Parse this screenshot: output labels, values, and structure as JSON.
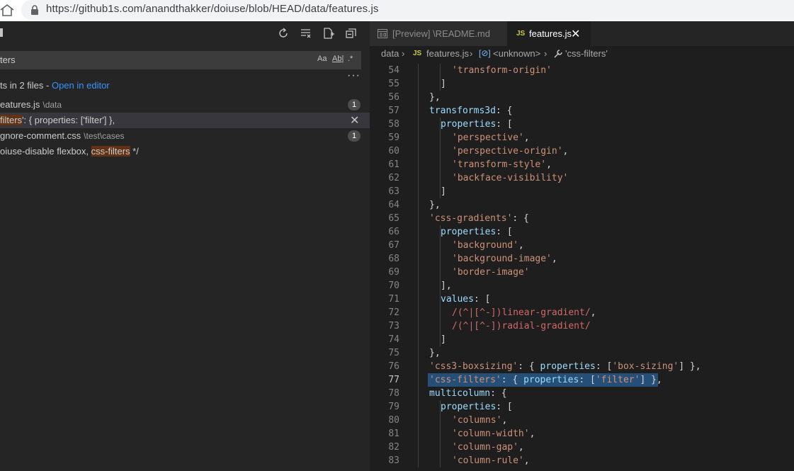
{
  "browser": {
    "url": "https://github1s.com/anandthakker/doiuse/blob/HEAD/data/features.js"
  },
  "search": {
    "query": "ters",
    "options": [
      "Aa",
      "Ab|",
      ".*"
    ],
    "summary_prefix": "ts in 2 files - ",
    "open_in_editor": "Open in editor"
  },
  "results": [
    {
      "file": "eatures.js",
      "path": "\\data",
      "count": "1"
    },
    {
      "match_pre": "",
      "match": "filters",
      "match_post": "': { properties: ['filter'] },"
    },
    {
      "file": "gnore-comment.css",
      "path": "\\test\\cases",
      "count": "1"
    },
    {
      "match_pre": "oiuse-disable flexbox, ",
      "match": "css-filters",
      "match_post": " */"
    }
  ],
  "tabs": [
    {
      "label": "[Preview] \\README.md",
      "active": false
    },
    {
      "label": "features.js",
      "active": true,
      "badge": "JS"
    }
  ],
  "breadcrumb": [
    "data",
    "features.js",
    "<unknown>",
    "'css-filters'"
  ],
  "code": {
    "current_line": 77,
    "lines": [
      {
        "n": "54",
        "tokens": [
          [
            "s",
            "'transform-origin'"
          ]
        ],
        "indent": 2
      },
      {
        "n": "55",
        "tokens": [
          [
            "p",
            "]"
          ]
        ],
        "indent": 1
      },
      {
        "n": "56",
        "tokens": [
          [
            "p",
            "},"
          ]
        ],
        "indent": 0
      },
      {
        "n": "57",
        "tokens": [
          [
            "k",
            "transforms3d"
          ],
          [
            "p",
            ": {"
          ]
        ],
        "indent": 0
      },
      {
        "n": "58",
        "tokens": [
          [
            "k",
            "properties"
          ],
          [
            "p",
            ": ["
          ]
        ],
        "indent": 1
      },
      {
        "n": "59",
        "tokens": [
          [
            "s",
            "'perspective'"
          ],
          [
            "p",
            ","
          ]
        ],
        "indent": 2
      },
      {
        "n": "60",
        "tokens": [
          [
            "s",
            "'perspective-origin'"
          ],
          [
            "p",
            ","
          ]
        ],
        "indent": 2
      },
      {
        "n": "61",
        "tokens": [
          [
            "s",
            "'transform-style'"
          ],
          [
            "p",
            ","
          ]
        ],
        "indent": 2
      },
      {
        "n": "62",
        "tokens": [
          [
            "s",
            "'backface-visibility'"
          ]
        ],
        "indent": 2
      },
      {
        "n": "63",
        "tokens": [
          [
            "p",
            "]"
          ]
        ],
        "indent": 1
      },
      {
        "n": "64",
        "tokens": [
          [
            "p",
            "},"
          ]
        ],
        "indent": 0
      },
      {
        "n": "65",
        "tokens": [
          [
            "s",
            "'css-gradients'"
          ],
          [
            "p",
            ": {"
          ]
        ],
        "indent": 0
      },
      {
        "n": "66",
        "tokens": [
          [
            "k",
            "properties"
          ],
          [
            "p",
            ": ["
          ]
        ],
        "indent": 1
      },
      {
        "n": "67",
        "tokens": [
          [
            "s",
            "'background'"
          ],
          [
            "p",
            ","
          ]
        ],
        "indent": 2
      },
      {
        "n": "68",
        "tokens": [
          [
            "s",
            "'background-image'"
          ],
          [
            "p",
            ","
          ]
        ],
        "indent": 2
      },
      {
        "n": "69",
        "tokens": [
          [
            "s",
            "'border-image'"
          ]
        ],
        "indent": 2
      },
      {
        "n": "70",
        "tokens": [
          [
            "p",
            "],"
          ]
        ],
        "indent": 1
      },
      {
        "n": "71",
        "tokens": [
          [
            "k",
            "values"
          ],
          [
            "p",
            ": ["
          ]
        ],
        "indent": 1
      },
      {
        "n": "72",
        "tokens": [
          [
            "r",
            "/(^|[^-])linear-gradient/"
          ],
          [
            "p",
            ","
          ]
        ],
        "indent": 2
      },
      {
        "n": "73",
        "tokens": [
          [
            "r",
            "/(^|[^-])radial-gradient/"
          ]
        ],
        "indent": 2
      },
      {
        "n": "74",
        "tokens": [
          [
            "p",
            "]"
          ]
        ],
        "indent": 1
      },
      {
        "n": "75",
        "tokens": [
          [
            "p",
            "},"
          ]
        ],
        "indent": 0
      },
      {
        "n": "76",
        "tokens": [
          [
            "s",
            "'css3-boxsizing'"
          ],
          [
            "p",
            ": { "
          ],
          [
            "k",
            "properties"
          ],
          [
            "p",
            ": ["
          ],
          [
            "s",
            "'box-sizing'"
          ],
          [
            "p",
            "] },"
          ]
        ],
        "indent": 0
      },
      {
        "n": "77",
        "tokens": [
          [
            "s",
            "'css-filters'"
          ],
          [
            "p",
            ": { "
          ],
          [
            "k",
            "properties"
          ],
          [
            "p",
            ": ["
          ],
          [
            "s",
            "'filter'"
          ],
          [
            "p",
            "] },"
          ]
        ],
        "indent": 0
      },
      {
        "n": "78",
        "tokens": [
          [
            "k",
            "multicolumn"
          ],
          [
            "p",
            ": {"
          ]
        ],
        "indent": 0
      },
      {
        "n": "79",
        "tokens": [
          [
            "k",
            "properties"
          ],
          [
            "p",
            ": ["
          ]
        ],
        "indent": 1
      },
      {
        "n": "80",
        "tokens": [
          [
            "s",
            "'columns'"
          ],
          [
            "p",
            ","
          ]
        ],
        "indent": 2
      },
      {
        "n": "81",
        "tokens": [
          [
            "s",
            "'column-width'"
          ],
          [
            "p",
            ","
          ]
        ],
        "indent": 2
      },
      {
        "n": "82",
        "tokens": [
          [
            "s",
            "'column-gap'"
          ],
          [
            "p",
            ","
          ]
        ],
        "indent": 2
      },
      {
        "n": "83",
        "tokens": [
          [
            "s",
            "'column-rule'"
          ],
          [
            "p",
            ","
          ]
        ],
        "indent": 2
      }
    ]
  }
}
